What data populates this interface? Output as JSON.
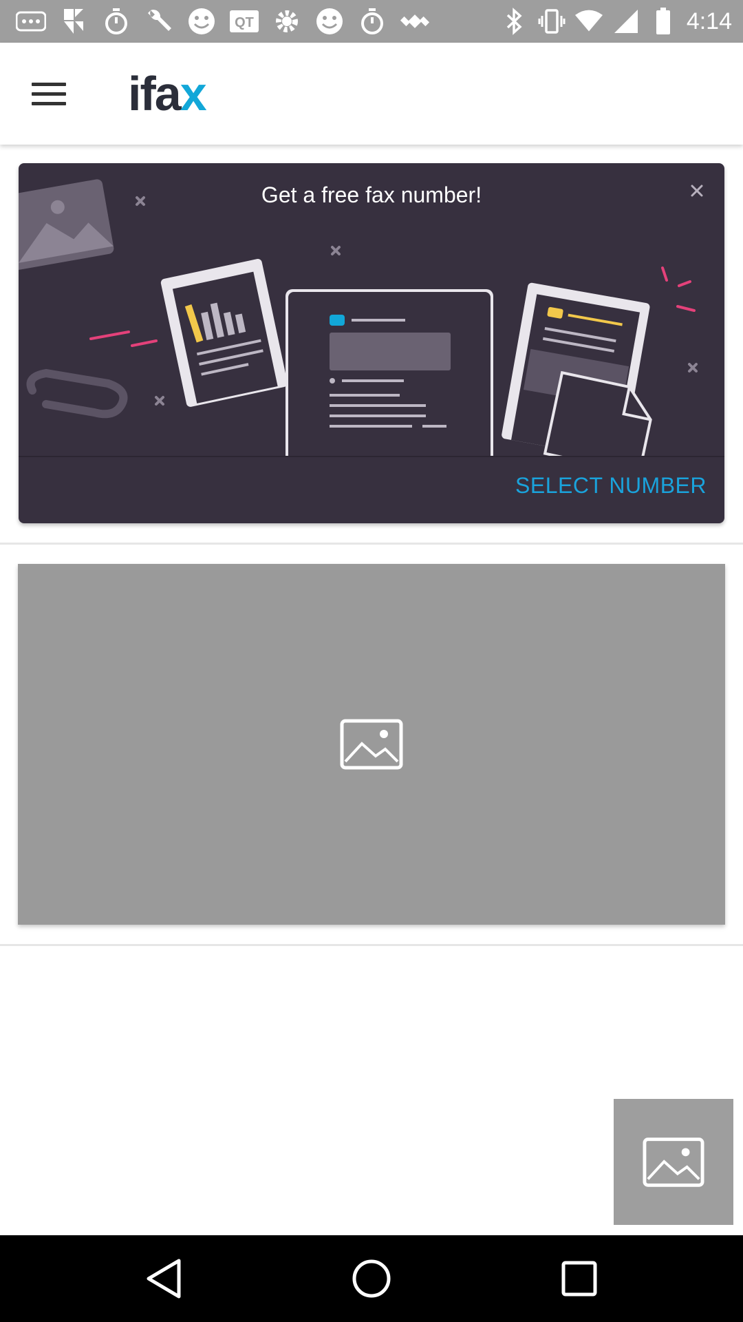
{
  "status_bar": {
    "time": "4:14",
    "left_icons": [
      "more-dots-icon",
      "pinwheel-icon",
      "timer-icon",
      "wrench-icon",
      "smiley-icon",
      "qt-icon",
      "gear-icon",
      "smiley-icon",
      "timer-icon",
      "satellite-icon"
    ],
    "right_icons": [
      "bluetooth-icon",
      "vibrate-icon",
      "wifi-icon",
      "signal-icon",
      "battery-icon"
    ],
    "background": "#9e9e9e"
  },
  "app_bar": {
    "logo_main": "ifa",
    "logo_accent": "x",
    "logo_color": "#2b2e3a",
    "accent_color": "#12a7d8"
  },
  "promo": {
    "title": "Get a free fax number!",
    "action_label": "SELECT NUMBER",
    "background": "#37303f",
    "action_color": "#1aa3dc"
  }
}
